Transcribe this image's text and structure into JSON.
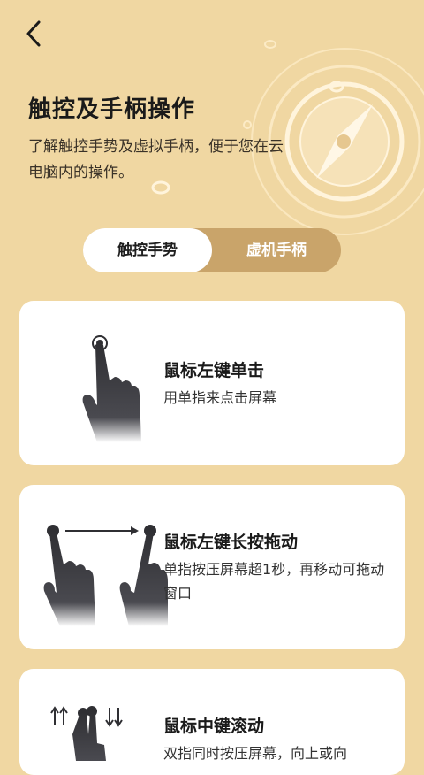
{
  "header": {
    "title": "触控及手柄操作",
    "description": "了解触控手势及虚拟手柄，便于您在云电脑内的操作。"
  },
  "tabs": [
    {
      "label": "触控手势",
      "active": true
    },
    {
      "label": "虚机手柄",
      "active": false
    }
  ],
  "cards": [
    {
      "title": "鼠标左键单击",
      "description": "用单指来点击屏幕",
      "icon": "single-tap-gesture-icon"
    },
    {
      "title": "鼠标左键长按拖动",
      "description": "单指按压屏幕超1秒，再移动可拖动窗口",
      "icon": "long-press-drag-gesture-icon"
    },
    {
      "title": "鼠标中键滚动",
      "description": "双指同时按压屏幕，向上或向",
      "icon": "two-finger-scroll-gesture-icon"
    }
  ],
  "colors": {
    "background": "#F0D7A2",
    "accent": "#C9A46A",
    "card": "#FFFFFF"
  }
}
